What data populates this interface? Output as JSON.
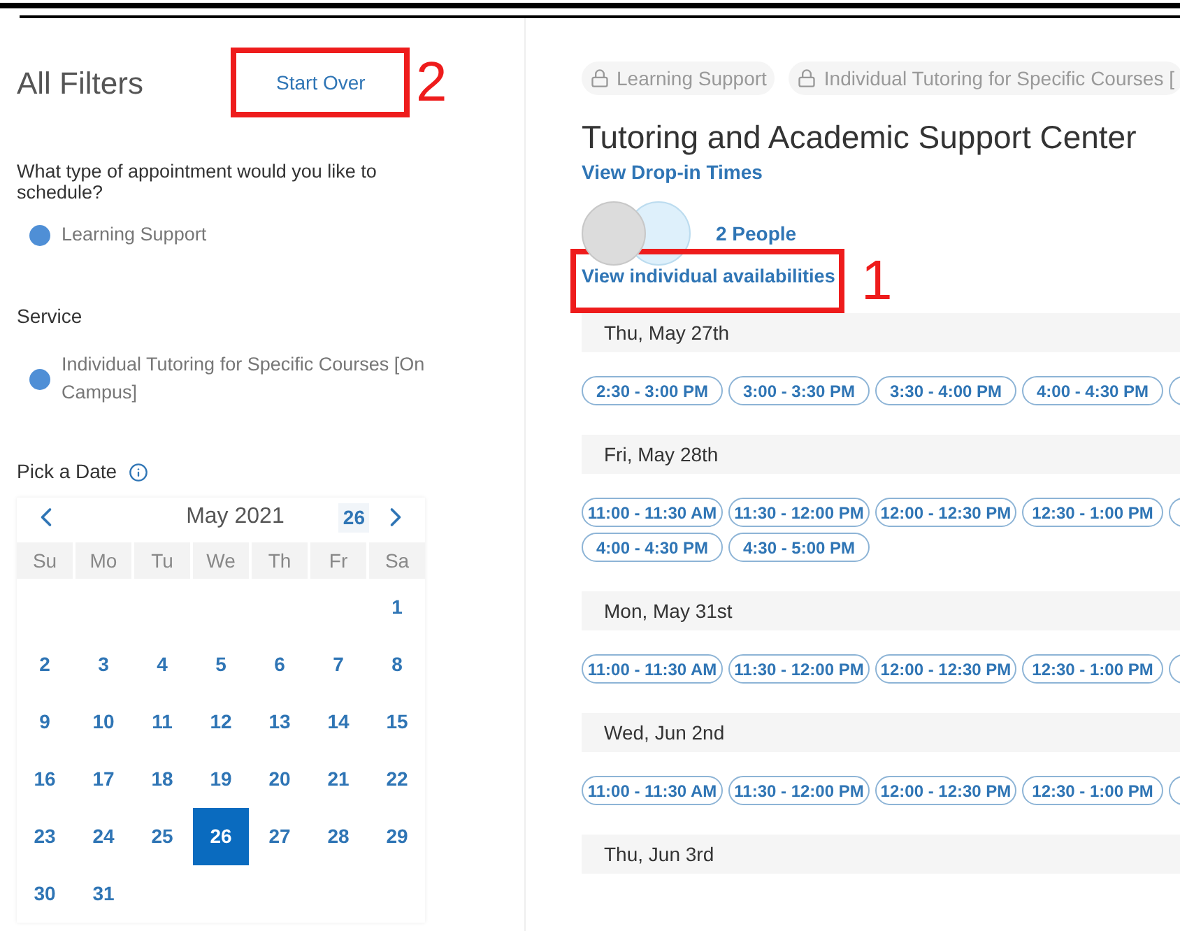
{
  "filters": {
    "title": "All Filters",
    "start_over": "Start Over",
    "annotation": "2"
  },
  "chips": [
    {
      "label": "Learning Support"
    },
    {
      "label": "Individual Tutoring for Specific Courses ["
    }
  ],
  "appointment_type": {
    "question": "What type of appointment would you like to schedule?",
    "option": "Learning Support"
  },
  "service": {
    "label": "Service",
    "option": "Individual Tutoring for Specific Courses [On Campus]"
  },
  "date_picker": {
    "label": "Pick a Date",
    "month": "May 2021",
    "today": "26",
    "weekdays": [
      "Su",
      "Mo",
      "Tu",
      "We",
      "Th",
      "Fr",
      "Sa"
    ],
    "weeks": [
      [
        {
          "kind": "blank"
        },
        {
          "kind": "blank"
        },
        {
          "kind": "blank"
        },
        {
          "kind": "blank"
        },
        {
          "kind": "blank"
        },
        {
          "kind": "blank"
        },
        {
          "kind": "day",
          "label": "1",
          "selected": false
        }
      ],
      [
        {
          "kind": "day",
          "label": "2",
          "selected": false
        },
        {
          "kind": "day",
          "label": "3",
          "selected": false
        },
        {
          "kind": "day",
          "label": "4",
          "selected": false
        },
        {
          "kind": "day",
          "label": "5",
          "selected": false
        },
        {
          "kind": "day",
          "label": "6",
          "selected": false
        },
        {
          "kind": "day",
          "label": "7",
          "selected": false
        },
        {
          "kind": "day",
          "label": "8",
          "selected": false
        }
      ],
      [
        {
          "kind": "day",
          "label": "9",
          "selected": false
        },
        {
          "kind": "day",
          "label": "10",
          "selected": false
        },
        {
          "kind": "day",
          "label": "11",
          "selected": false
        },
        {
          "kind": "day",
          "label": "12",
          "selected": false
        },
        {
          "kind": "day",
          "label": "13",
          "selected": false
        },
        {
          "kind": "day",
          "label": "14",
          "selected": false
        },
        {
          "kind": "day",
          "label": "15",
          "selected": false
        }
      ],
      [
        {
          "kind": "day",
          "label": "16",
          "selected": false
        },
        {
          "kind": "day",
          "label": "17",
          "selected": false
        },
        {
          "kind": "day",
          "label": "18",
          "selected": false
        },
        {
          "kind": "day",
          "label": "19",
          "selected": false
        },
        {
          "kind": "day",
          "label": "20",
          "selected": false
        },
        {
          "kind": "day",
          "label": "21",
          "selected": false
        },
        {
          "kind": "day",
          "label": "22",
          "selected": false
        }
      ],
      [
        {
          "kind": "day",
          "label": "23",
          "selected": false
        },
        {
          "kind": "day",
          "label": "24",
          "selected": false
        },
        {
          "kind": "day",
          "label": "25",
          "selected": false
        },
        {
          "kind": "day",
          "label": "26",
          "selected": true
        },
        {
          "kind": "day",
          "label": "27",
          "selected": false
        },
        {
          "kind": "day",
          "label": "28",
          "selected": false
        },
        {
          "kind": "day",
          "label": "29",
          "selected": false
        }
      ],
      [
        {
          "kind": "day",
          "label": "30",
          "selected": false
        },
        {
          "kind": "day",
          "label": "31",
          "selected": false
        }
      ]
    ]
  },
  "center": {
    "title": "Tutoring and Academic Support Center",
    "drop_in_link": "View Drop-in Times",
    "people": "2 People",
    "availability_link": "View individual availabilities",
    "annotation": "1"
  },
  "days": [
    {
      "date": "Thu, May 27th",
      "slots": [
        "2:30 - 3:00 PM",
        "3:00 - 3:30 PM",
        "3:30 - 4:00 PM",
        "4:00 - 4:30 PM"
      ]
    },
    {
      "date": "Fri, May 28th",
      "slots": [
        "11:00 - 11:30 AM",
        "11:30 - 12:00 PM",
        "12:00 - 12:30 PM",
        "12:30 - 1:00 PM"
      ],
      "slots_2": [
        "4:00 - 4:30 PM",
        "4:30 - 5:00 PM"
      ]
    },
    {
      "date": "Mon, May 31st",
      "slots": [
        "11:00 - 11:30 AM",
        "11:30 - 12:00 PM",
        "12:00 - 12:30 PM",
        "12:30 - 1:00 PM"
      ]
    },
    {
      "date": "Wed, Jun 2nd",
      "slots": [
        "11:00 - 11:30 AM",
        "11:30 - 12:00 PM",
        "12:00 - 12:30 PM",
        "12:30 - 1:00 PM"
      ]
    },
    {
      "date": "Thu, Jun 3rd"
    }
  ]
}
